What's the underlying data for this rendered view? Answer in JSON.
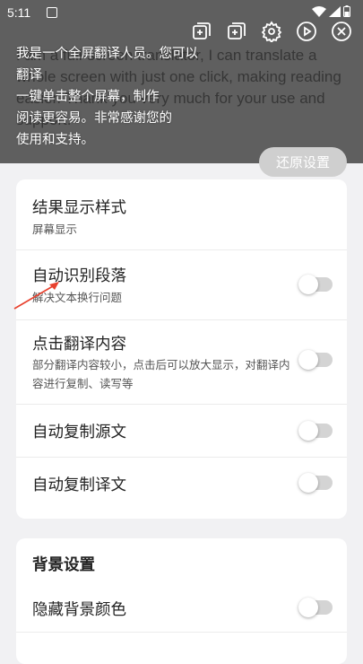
{
  "status_bar": {
    "time": "5:11"
  },
  "overlay": {
    "source_text": "I am a full-screen translator, I can translate a whole screen with just one click, making reading easier. Thank you very much for your use and support.",
    "translated_lines": [
      "我是一个全屏翻译人员。您可以翻译",
      "一键单击整个屏幕，制作",
      "阅读更容易。非常感谢您的",
      "使用和支持。"
    ]
  },
  "toolbar": {
    "icons": [
      "add-copy-icon",
      "add-copy-icon",
      "gear-icon",
      "play-icon",
      "close-icon"
    ]
  },
  "restore_button": {
    "label": "还原设置"
  },
  "display_settings": {
    "result_style": {
      "title": "结果显示样式",
      "subtitle": "屏幕显示"
    },
    "auto_paragraph": {
      "title": "自动识别段落",
      "subtitle": "解决文本换行问题",
      "enabled": false
    },
    "tap_translation": {
      "title": "点击翻译内容",
      "subtitle": "部分翻译内容较小，点击后可以放大显示，对翻译内容进行复制、读写等",
      "enabled": false
    },
    "auto_copy_source": {
      "title": "自动复制源文",
      "enabled": false
    },
    "auto_copy_translation": {
      "title": "自动复制译文",
      "enabled": false
    }
  },
  "background_settings": {
    "section_title": "背景设置",
    "hide_bg_color": {
      "title": "隐藏背景颜色",
      "enabled": false
    }
  },
  "colors": {
    "overlay": "#5f5f5f",
    "page_bg": "#f1f1f3",
    "toggle_track": "#d4d4d4",
    "arrow": "#e8412e"
  }
}
